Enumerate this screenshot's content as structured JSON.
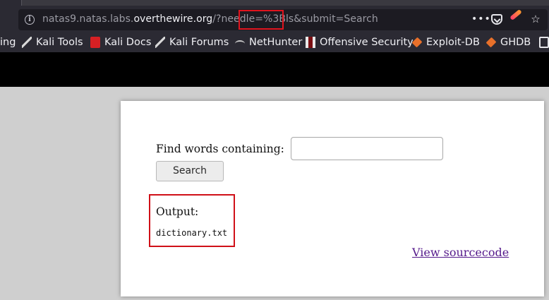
{
  "browser": {
    "url_prefix": "natas9.natas.labs.",
    "url_domain": "overthewire.org",
    "url_path": "/?needle=%3Bls&submit=Search",
    "info_icon_glyph": "i",
    "menu_glyph": "•••",
    "star_glyph": "☆"
  },
  "bookmarks": [
    {
      "label": "ing",
      "icon": "none"
    },
    {
      "label": "Kali Tools",
      "icon": "kali-dragon-icon"
    },
    {
      "label": "Kali Docs",
      "icon": "kali-docs-icon"
    },
    {
      "label": "Kali Forums",
      "icon": "kali-dragon-icon"
    },
    {
      "label": "NetHunter",
      "icon": "nethunter-icon"
    },
    {
      "label": "Offensive Security",
      "icon": "offsec-icon"
    },
    {
      "label": "Exploit-DB",
      "icon": "exploitdb-icon"
    },
    {
      "label": "GHDB",
      "icon": "exploitdb-icon"
    }
  ],
  "page": {
    "form_label": "Find words containing:",
    "search_input_value": "",
    "search_button": "Search",
    "output_label": "Output:",
    "output_text": "dictionary.txt",
    "source_link": "View sourcecode"
  },
  "colors": {
    "highlight": "#e0141e",
    "link_visited": "#551a8b",
    "browser_chrome": "#2b2a33"
  }
}
